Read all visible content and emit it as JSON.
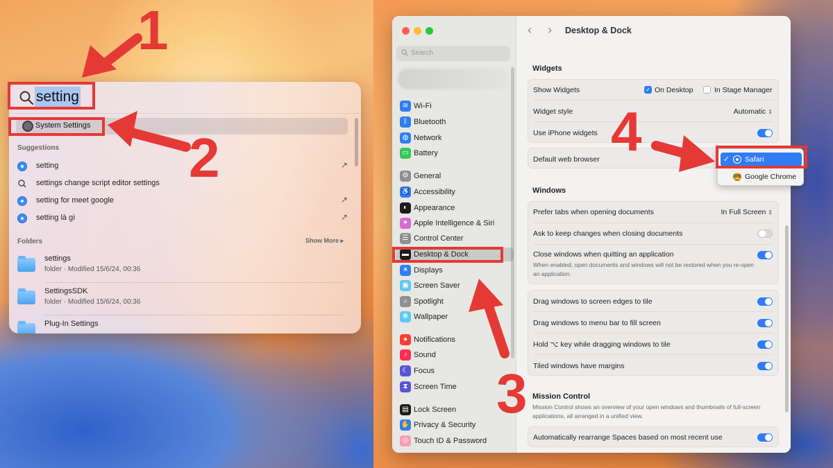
{
  "spotlight": {
    "query": "setting",
    "top_hit": "System Settings",
    "suggestions_label": "Suggestions",
    "suggestions": [
      {
        "text": "setting",
        "icon": "safari-icon"
      },
      {
        "text": "settings change script editor settings",
        "icon": "search-icon"
      },
      {
        "text": "setting for meet google",
        "icon": "safari-icon"
      },
      {
        "text": "setting là gì",
        "icon": "safari-icon"
      }
    ],
    "folders_label": "Folders",
    "show_more": "Show More",
    "folders": [
      {
        "name": "settings",
        "meta": "folder · Modified 15/6/24, 00:36"
      },
      {
        "name": "SettingsSDK",
        "meta": "folder · Modified 15/6/24, 00:36"
      },
      {
        "name": "Plug-In Settings",
        "meta": ""
      }
    ]
  },
  "annotations": {
    "n1": "1",
    "n2": "2",
    "n3": "3",
    "n4": "4",
    "color": "#e53935"
  },
  "settings": {
    "search_placeholder": "Search",
    "title": "Desktop & Dock",
    "sidebar": [
      {
        "label": "Wi-Fi",
        "color": "#2f7cf6",
        "glyph": "≋"
      },
      {
        "label": "Bluetooth",
        "color": "#2f7cf6",
        "glyph": "ᛒ"
      },
      {
        "label": "Network",
        "color": "#2f7cf6",
        "glyph": "◍"
      },
      {
        "label": "Battery",
        "color": "#34c759",
        "glyph": "▭"
      },
      {
        "label": "General",
        "color": "#8e8e93",
        "glyph": "⚙"
      },
      {
        "label": "Accessibility",
        "color": "#2f7cf6",
        "glyph": "♿"
      },
      {
        "label": "Appearance",
        "color": "#1c1c1e",
        "glyph": "◐"
      },
      {
        "label": "Apple Intelligence & Siri",
        "color": "#d36bd8",
        "glyph": "✦"
      },
      {
        "label": "Control Center",
        "color": "#8e8e93",
        "glyph": "☰"
      },
      {
        "label": "Desktop & Dock",
        "color": "#1c1c1e",
        "glyph": "▬"
      },
      {
        "label": "Displays",
        "color": "#2f7cf6",
        "glyph": "☀"
      },
      {
        "label": "Screen Saver",
        "color": "#5ac8fa",
        "glyph": "▣"
      },
      {
        "label": "Spotlight",
        "color": "#8e8e93",
        "glyph": "⌕"
      },
      {
        "label": "Wallpaper",
        "color": "#5ac8fa",
        "glyph": "❋"
      },
      {
        "label": "Notifications",
        "color": "#ff3b30",
        "glyph": "●"
      },
      {
        "label": "Sound",
        "color": "#ff2d55",
        "glyph": "♪"
      },
      {
        "label": "Focus",
        "color": "#5856d6",
        "glyph": "☾"
      },
      {
        "label": "Screen Time",
        "color": "#5856d6",
        "glyph": "⧗"
      },
      {
        "label": "Lock Screen",
        "color": "#1c1c1e",
        "glyph": "▤"
      },
      {
        "label": "Privacy & Security",
        "color": "#2f7cf6",
        "glyph": "✋"
      },
      {
        "label": "Touch ID & Password",
        "color": "#ff9bb0",
        "glyph": "◎"
      }
    ],
    "widgets": {
      "header": "Widgets",
      "show_widgets": "Show Widgets",
      "on_desktop": "On Desktop",
      "in_stage_manager": "In Stage Manager",
      "widget_style": "Widget style",
      "widget_style_value": "Automatic",
      "use_iphone": "Use iPhone widgets",
      "default_browser": "Default web browser"
    },
    "browser_menu": {
      "selected": "Safari",
      "other": "Google Chrome"
    },
    "windows": {
      "header": "Windows",
      "prefer_tabs": "Prefer tabs when opening documents",
      "prefer_tabs_value": "In Full Screen",
      "ask_keep": "Ask to keep changes when closing documents",
      "close_windows": "Close windows when quitting an application",
      "close_windows_sub": "When enabled, open documents and windows will not be restored when you re-open an application.",
      "drag_edges": "Drag windows to screen edges to tile",
      "drag_menu": "Drag windows to menu bar to fill screen",
      "hold_key": "Hold ⌥ key while dragging windows to tile",
      "tiled_margins": "Tiled windows have margins"
    },
    "mission": {
      "header": "Mission Control",
      "sub": "Mission Control shows an overview of your open windows and thumbnails of full-screen applications, all arranged in a unified view.",
      "auto_rearrange": "Automatically rearrange Spaces based on most recent use"
    }
  }
}
